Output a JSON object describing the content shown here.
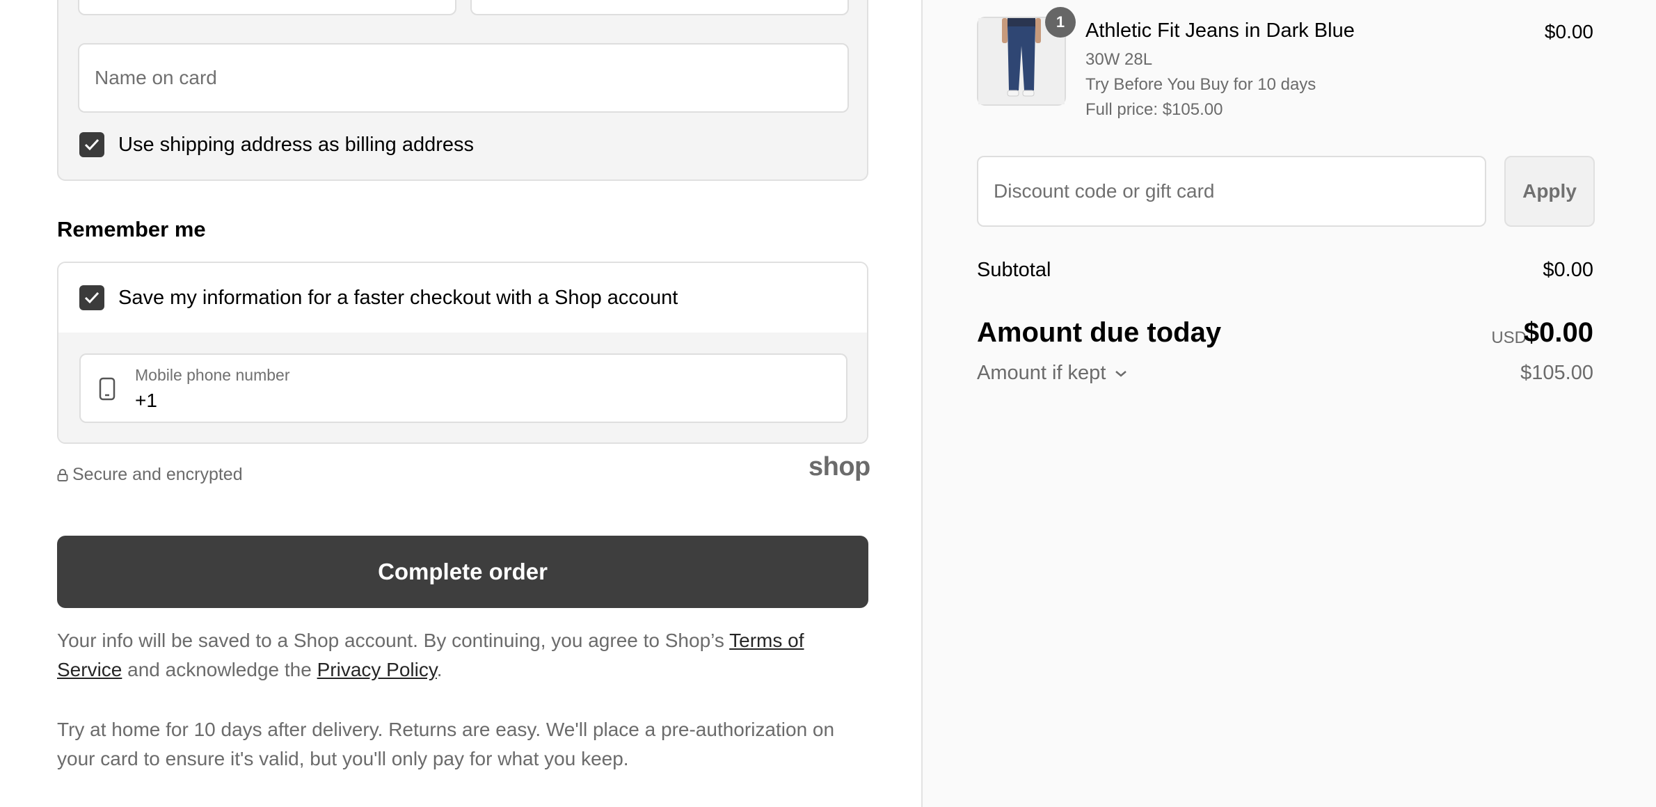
{
  "billing": {
    "name_on_card_placeholder": "Name on card",
    "use_shipping_label": "Use shipping address as billing address",
    "use_shipping_checked": true
  },
  "remember": {
    "heading": "Remember me",
    "save_info_label": "Save my information for a faster checkout with a Shop account",
    "save_info_checked": true,
    "phone_label": "Mobile phone number",
    "phone_value": "+1"
  },
  "secure": {
    "text": "Secure and encrypted",
    "shop_logo": "shop"
  },
  "complete_order": "Complete order",
  "legal": {
    "prefix": "Your info will be saved to a Shop account. By continuing, you agree to Shop’s ",
    "terms_link": "Terms of Service",
    "middle": " and acknowledge the ",
    "privacy_link": "Privacy Policy",
    "suffix": "."
  },
  "try_at_home": "Try at home for 10 days after delivery. Returns are easy. We'll place a pre-authorization on your card to ensure it's valid, but you'll only pay for what you keep.",
  "order": {
    "item": {
      "quantity": "1",
      "title": "Athletic Fit Jeans in Dark Blue",
      "variant": "30W 28L",
      "trial": "Try Before You Buy for 10 days",
      "full_price": "Full price: $105.00",
      "price": "$0.00"
    },
    "discount_placeholder": "Discount code or gift card",
    "apply_label": "Apply",
    "subtotal_label": "Subtotal",
    "subtotal_value": "$0.00",
    "due_label": "Amount due today",
    "due_currency": "USD",
    "due_value": "$0.00",
    "kept_label": "Amount if kept",
    "kept_value": "$105.00"
  },
  "colors": {
    "accent_dark": "#3e3e3e",
    "panel_bg": "#fafafa",
    "muted_text": "#6b6b6b"
  }
}
